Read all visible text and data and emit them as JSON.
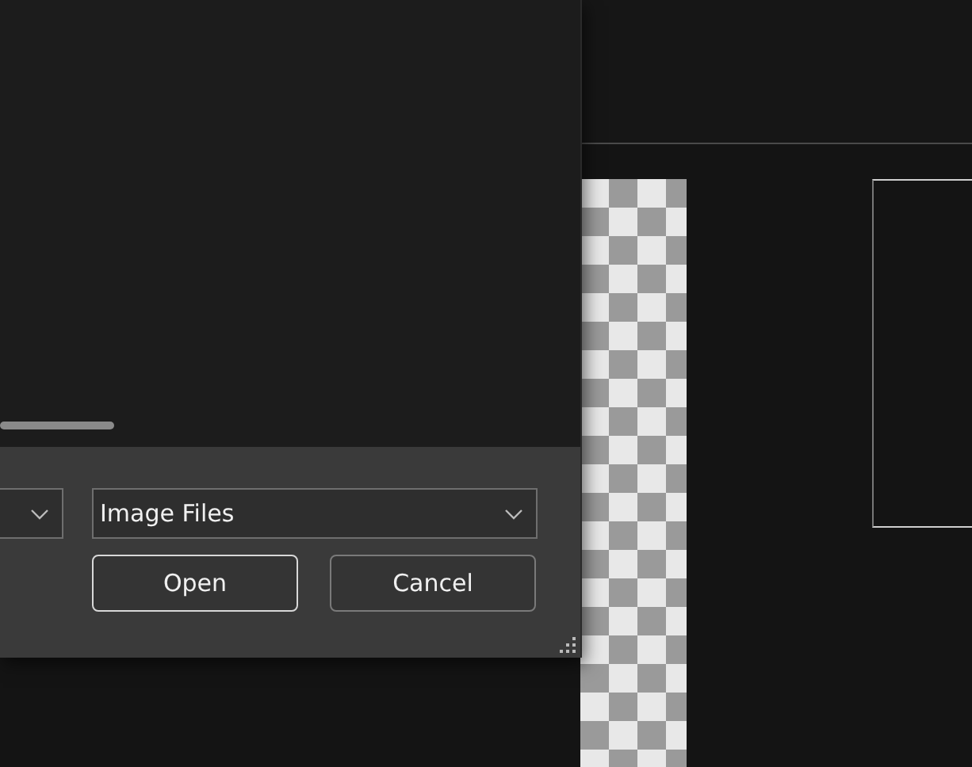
{
  "dialog": {
    "file_type_filter": {
      "value": "Image Files"
    },
    "buttons": [
      {
        "label": "Open",
        "default": true
      },
      {
        "label": "Cancel",
        "default": false
      }
    ]
  }
}
